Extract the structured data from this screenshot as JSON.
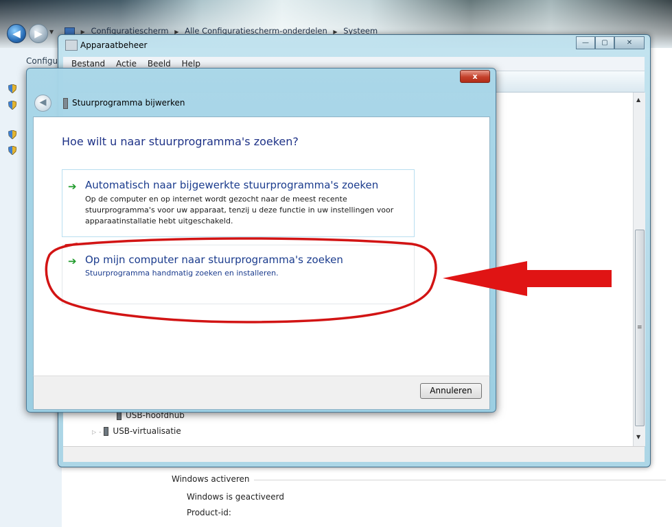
{
  "control_panel": {
    "breadcrumb": [
      "Configuratiescherm",
      "Alle Configuratiescherm-onderdelen",
      "Systeem"
    ],
    "side_label": "Configu",
    "activation_group_title": "Windows activeren",
    "activation_status": "Windows is geactiveerd",
    "product_id_label": "Product-id:"
  },
  "device_manager": {
    "title": "Apparaatbeheer",
    "menu": [
      "Bestand",
      "Actie",
      "Beeld",
      "Help"
    ],
    "tree_items": [
      {
        "label": "USB-hoofdhub"
      },
      {
        "label": "USB-virtualisatie"
      }
    ],
    "scroll_mark": "≡"
  },
  "dialog": {
    "title": "Stuurprogramma bijwerken",
    "close_glyph": "x",
    "question": "Hoe wilt u naar stuurprogramma's zoeken?",
    "options": [
      {
        "title": "Automatisch naar bijgewerkte stuurprogramma's zoeken",
        "description": "Op de computer en op internet wordt gezocht naar de meest recente stuurprogramma's voor uw apparaat, tenzij u deze functie in uw instellingen voor apparaatinstallatie hebt uitgeschakeld."
      },
      {
        "title": "Op mijn computer naar stuurprogramma's zoeken",
        "description": "Stuurprogramma handmatig zoeken en installeren."
      }
    ],
    "cancel_label": "Annuleren"
  },
  "annotation": {
    "highlight_color": "#d21414",
    "highlight_target": "Op mijn computer naar stuurprogramma's zoeken"
  }
}
